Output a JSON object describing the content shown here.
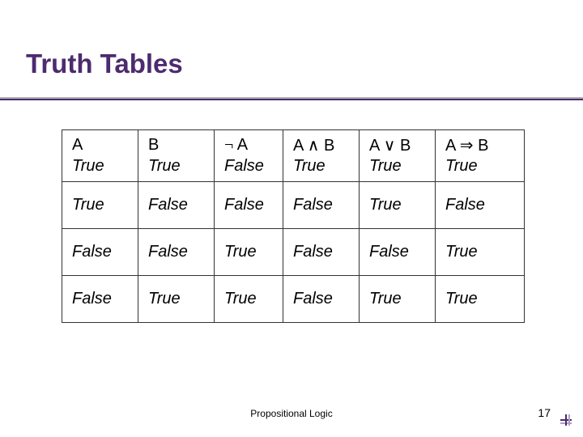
{
  "slide": {
    "title": "Truth Tables",
    "footer_center": "Propositional Logic",
    "page_number": "17"
  },
  "table": {
    "headers": {
      "a": "A",
      "b": "B",
      "not_a_prefix": "¬",
      "not_a_suffix": " A",
      "and_a": "A ",
      "and_op": "∧",
      "and_b": " B",
      "or_a": "A ",
      "or_op": "∨",
      "or_b": " B",
      "imp_a": "A ",
      "imp_op": "⇒",
      "imp_b": " B"
    },
    "rows": [
      {
        "a": "True",
        "b": "True",
        "na": "False",
        "and": "True",
        "or": "True",
        "imp": "True"
      },
      {
        "a": "True",
        "b": "False",
        "na": "False",
        "and": "False",
        "or": "True",
        "imp": "False"
      },
      {
        "a": "False",
        "b": "False",
        "na": "True",
        "and": "False",
        "or": "False",
        "imp": "True"
      },
      {
        "a": "False",
        "b": "True",
        "na": "True",
        "and": "False",
        "or": "True",
        "imp": "True"
      }
    ]
  }
}
